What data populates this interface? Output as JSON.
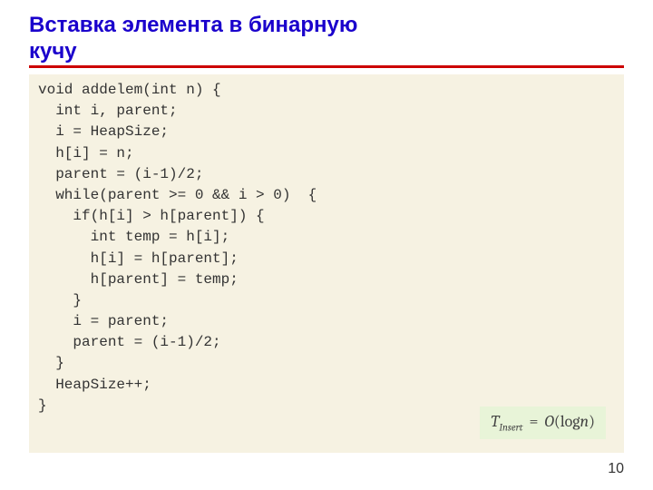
{
  "title_line1": "Вставка элемента в бинарную",
  "title_line2": "кучу",
  "code": "void addelem(int n) {\n  int i, parent;\n  i = HeapSize;\n  h[i] = n;\n  parent = (i-1)/2;\n  while(parent >= 0 && i > 0)  {\n    if(h[i] > h[parent]) {\n      int temp = h[i];\n      h[i] = h[parent];\n      h[parent] = temp;\n    }\n    i = parent;\n    parent = (i-1)/2;\n  }\n  HeapSize++;\n}",
  "complexity": {
    "T_symbol": "T",
    "T_sub": "Insert",
    "eq": " = ",
    "O_symbol": "O",
    "open": "(",
    "log": "log",
    "n": "n",
    "close": ")"
  },
  "page_number": "10"
}
